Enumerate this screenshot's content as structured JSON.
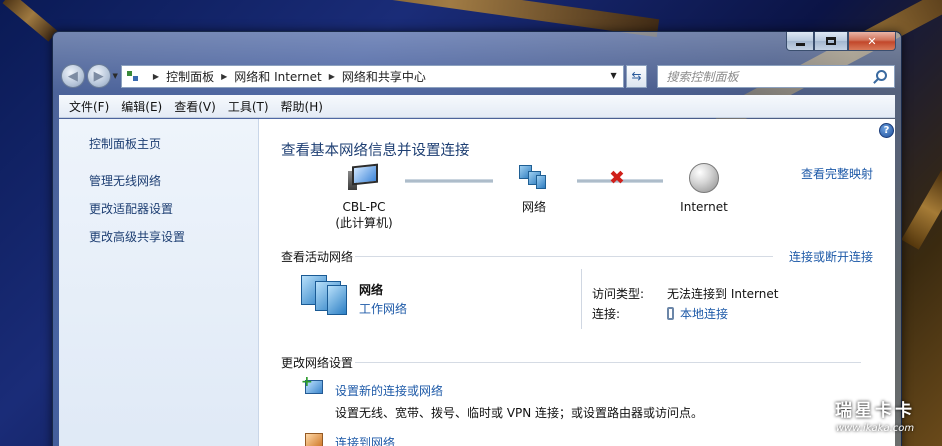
{
  "window": {
    "caption": {
      "minimize": "minimize",
      "maximize": "maximize",
      "close": "close"
    }
  },
  "navigation": {
    "address_path": [
      "控制面板",
      "网络和 Internet",
      "网络和共享中心"
    ],
    "search_placeholder": "搜索控制面板"
  },
  "menubar": {
    "items": [
      "文件(F)",
      "编辑(E)",
      "查看(V)",
      "工具(T)",
      "帮助(H)"
    ]
  },
  "sidebar": {
    "home": "控制面板主页",
    "links": [
      "管理无线网络",
      "更改适配器设置",
      "更改高级共享设置"
    ]
  },
  "main": {
    "title": "查看基本网络信息并设置连接",
    "full_map_link": "查看完整映射",
    "map": {
      "computer_name": "CBL-PC",
      "computer_caption": "(此计算机)",
      "network_label": "网络",
      "internet_label": "Internet",
      "internet_status": "disconnected"
    },
    "active_networks": {
      "heading": "查看活动网络",
      "connect_link": "连接或断开连接",
      "network_name": "网络",
      "network_type": "工作网络",
      "access_type_label": "访问类型:",
      "access_type_value": "无法连接到 Internet",
      "connection_label": "连接:",
      "connection_value": "本地连接"
    },
    "change_settings": {
      "heading": "更改网络设置",
      "tasks": [
        {
          "title": "设置新的连接或网络",
          "desc": "设置无线、宽带、拨号、临时或 VPN 连接；或设置路由器或访问点。"
        },
        {
          "title": "连接到网络"
        }
      ]
    }
  },
  "watermark": {
    "title": "瑞星卡卡",
    "url": "www.ikaka.com"
  },
  "colors": {
    "link": "#1e5aa8",
    "title": "#1e3f73",
    "error_x": "#d0201a"
  }
}
